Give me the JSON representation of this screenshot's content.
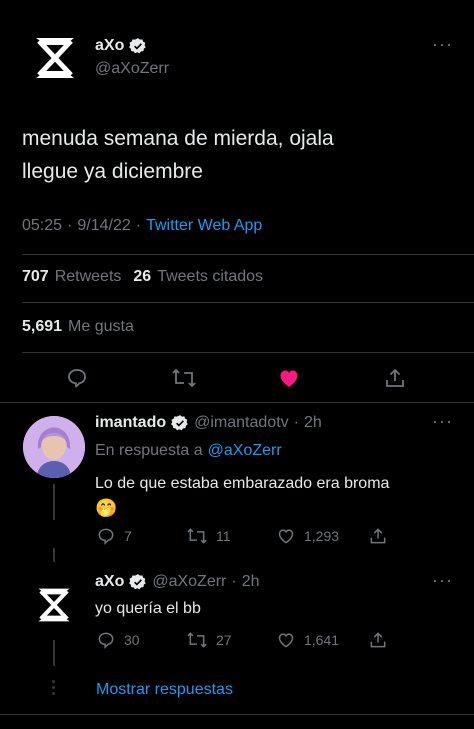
{
  "tweet": {
    "author_name": "aXo",
    "author_handle": "@aXoZerr",
    "text_line1": "menuda semana de mierda, ojala",
    "text_line2": "llegue ya diciembre",
    "time": "05:25",
    "dot1": "·",
    "date": "9/14/22",
    "dot2": "·",
    "source": "Twitter Web App",
    "retweets_count": "707",
    "retweets_label": "Retweets",
    "quotes_count": "26",
    "quotes_label": "Tweets citados",
    "likes_count": "5,691",
    "likes_label": "Me gusta",
    "liked": true,
    "like_color": "#f91880"
  },
  "replies": [
    {
      "author_name": "imantado",
      "author_handle": "@imantadotv",
      "dot": "·",
      "age": "2h",
      "reply_prefix": "En respuesta a",
      "reply_to": "@aXoZerr",
      "text": "Lo de que estaba embarazado era broma",
      "emoji": "🤭",
      "replies": "7",
      "retweets": "11",
      "likes": "1,293"
    },
    {
      "author_name": "aXo",
      "author_handle": "@aXoZerr",
      "dot": "·",
      "age": "2h",
      "text": "yo quería el bb",
      "replies": "30",
      "retweets": "27",
      "likes": "1,641"
    }
  ],
  "show_replies_label": "Mostrar respuestas",
  "colors": {
    "accent": "#1d9bf0",
    "muted": "#71767b",
    "border": "#2f3336",
    "background": "#000000"
  }
}
